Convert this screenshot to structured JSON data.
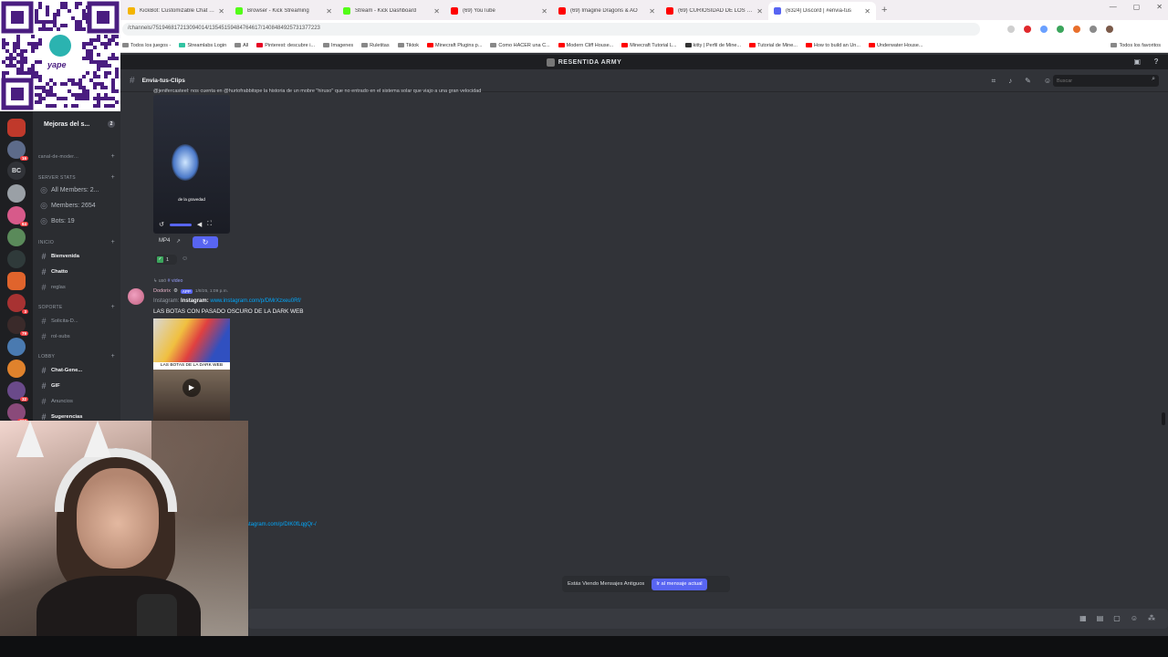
{
  "browser": {
    "tabs": [
      {
        "label": "KickBot: Customizable Chat Bot",
        "color": "#f4b400",
        "active": false
      },
      {
        "label": "Browser - Kick Streaming",
        "color": "#53fc18",
        "active": false
      },
      {
        "label": "Stream - Kick Dashboard",
        "color": "#53fc18",
        "active": false
      },
      {
        "label": "(69) YouTube",
        "color": "#ff0000",
        "active": false
      },
      {
        "label": "(69) Imagine Dragons & AO",
        "color": "#ff0000",
        "active": false
      },
      {
        "label": "(69) CURIOSIDAD DE LOS ORI",
        "color": "#ff0000",
        "active": false
      },
      {
        "label": "(6324) Discord | #envia-tus",
        "color": "#5865f2",
        "active": true
      }
    ],
    "new_tab": "+",
    "url": "/channels/751946817213094014/13545159484764617/1408484925731377223",
    "bookmarks": [
      {
        "label": "Todos los juegos -",
        "color": "#888888"
      },
      {
        "label": "Streamlabs Login",
        "color": "#31c3a2"
      },
      {
        "label": "All",
        "color": "#888888"
      },
      {
        "label": "Pinterest: descubre i...",
        "color": "#e60023"
      },
      {
        "label": "Imagenes",
        "color": "#888888"
      },
      {
        "label": "Ruletitas",
        "color": "#888888"
      },
      {
        "label": "Tiktok",
        "color": "#888888"
      },
      {
        "label": "Minecraft Plugins p...",
        "color": "#ff0000"
      },
      {
        "label": "Como HACER una C...",
        "color": "#888888"
      },
      {
        "label": "Modern Cliff House...",
        "color": "#ff0000"
      },
      {
        "label": "Minecraft Tutorial L...",
        "color": "#ff0000"
      },
      {
        "label": "kitty | Perfil de Mine...",
        "color": "#333333"
      },
      {
        "label": "Tutorial de Mine...",
        "color": "#ff0000"
      },
      {
        "label": "How to build an Un...",
        "color": "#ff0000"
      },
      {
        "label": "Underwater House...",
        "color": "#ff0000"
      }
    ],
    "all_bookmarks": "Todos los favoritos"
  },
  "discord": {
    "server_name": "RESENTIDA ARMY",
    "channel_header": "Envia-tus-Clips",
    "search_placeholder": "Buscar",
    "server_list_label": "BC",
    "channels": {
      "top": {
        "label": "Mejoras del s...",
        "badge": "2"
      },
      "items": [
        {
          "label": "canal-de-moder...",
          "kind": "cat"
        },
        {
          "label": "SERVER STATS",
          "kind": "cat"
        },
        {
          "label": "All Members: 2...",
          "kind": "big"
        },
        {
          "label": "Members: 2654",
          "kind": "big"
        },
        {
          "label": "Bots: 19",
          "kind": "big"
        },
        {
          "label": "INICIO",
          "kind": "cat"
        },
        {
          "label": "Bienvenida",
          "kind": "bold"
        },
        {
          "label": "Chatto",
          "kind": "bold"
        },
        {
          "label": "reglas",
          "kind": "normal"
        },
        {
          "label": "SOPORTE",
          "kind": "cat"
        },
        {
          "label": "Solicita-D...",
          "kind": "normal"
        },
        {
          "label": "rol-subs",
          "kind": "normal"
        },
        {
          "label": "LOBBY",
          "kind": "cat"
        },
        {
          "label": "Chat-Gene...",
          "kind": "bold"
        },
        {
          "label": "GIF",
          "kind": "bold"
        },
        {
          "label": "Anuncios",
          "kind": "normal"
        },
        {
          "label": "Sugerencias",
          "kind": "bold"
        }
      ]
    },
    "messages": {
      "cut_text": "@jenifercasteel: nos cuenta en @hurtofrabbitspe la historia de un mobre \"hiruso\" que no entrado en el sistema solar que viajo a una gran velocidad",
      "video_caption": "de la gravedad",
      "format_label": "MP4",
      "reaction_count": "1",
      "reply_prefix": "",
      "reply_mid": "usó",
      "reply_link": "# video",
      "author": "Dodorix",
      "app_badge": "APP",
      "timestamp": "1/8/25, 1:09 p.m.",
      "link_label": "Instagram:",
      "link_label_bold": "Instagram:",
      "link_url": "www.instagram.com/p/DMrXzxeu0Rf/",
      "body": "LAS BOTAS CON PASADO OSCURO DE LA DARK WEB",
      "thumb_caption": "LAS BOTAS DE LA DARK WEB",
      "second_link": "stagram.com/p/DIK0fLqgQr-/"
    },
    "notice": {
      "text": "Estás Viendo Mensajes Antiguos",
      "button": "Ir al mensaje actual"
    }
  }
}
